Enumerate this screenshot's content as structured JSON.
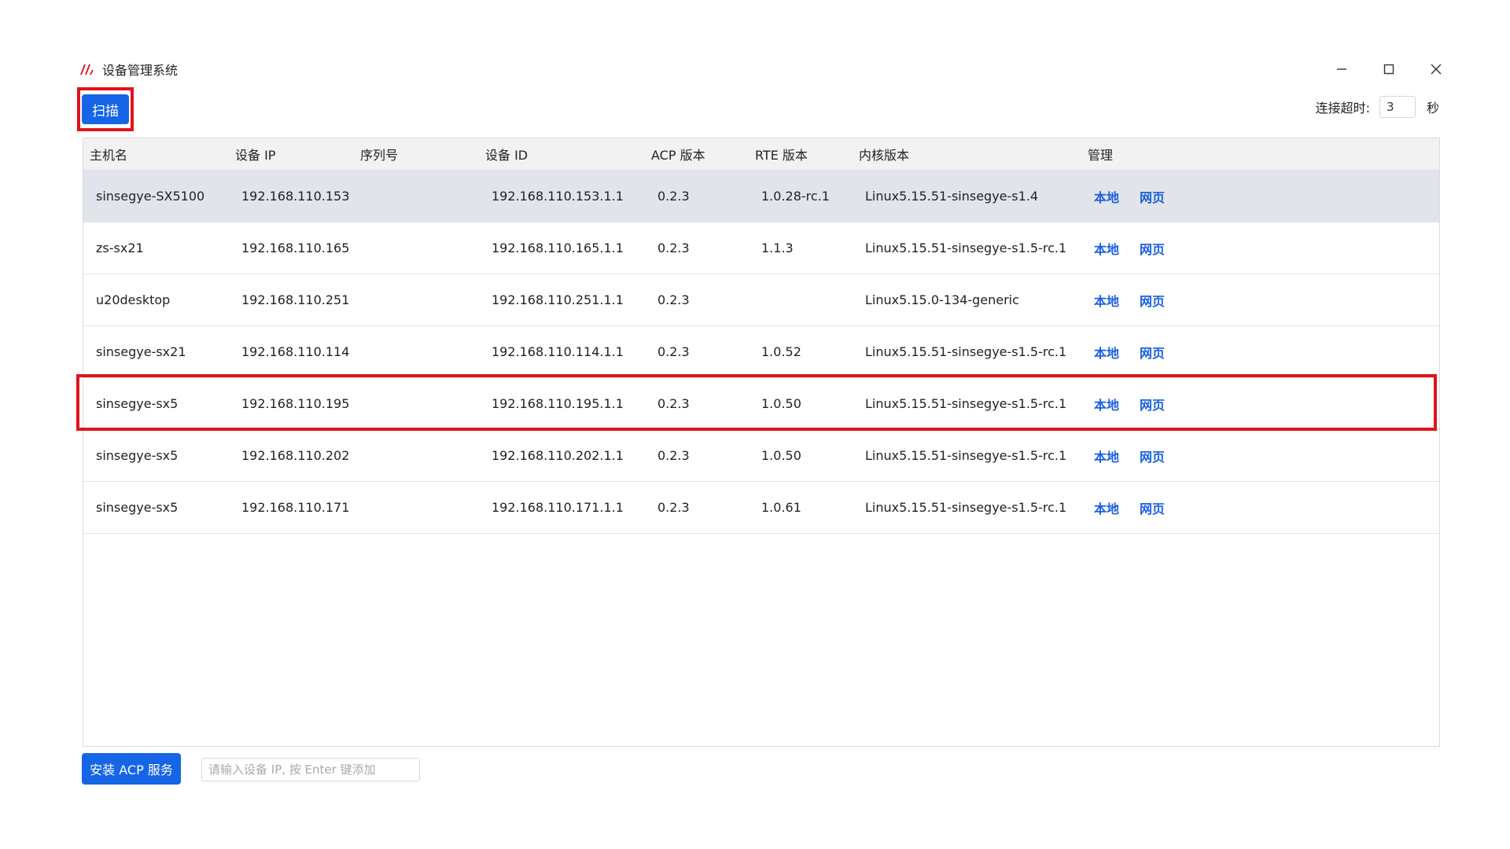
{
  "window": {
    "title": "设备管理系统",
    "controls": [
      "minimize-icon",
      "maximize-icon",
      "close-icon"
    ]
  },
  "toolbar": {
    "scan_label": "扫描",
    "timeout_label": "连接超时:",
    "timeout_value": "3",
    "timeout_unit": "秒"
  },
  "table": {
    "headers": {
      "host": "主机名",
      "ip": "设备 IP",
      "sn": "序列号",
      "id": "设备 ID",
      "acp": "ACP 版本",
      "rte": "RTE 版本",
      "kernel": "内核版本",
      "mgmt": "管理"
    },
    "rows": [
      {
        "host": "sinsegye-SX5100",
        "ip": "192.168.110.153",
        "sn": "",
        "id": "192.168.110.153.1.1",
        "acp": "0.2.3",
        "rte": "1.0.28-rc.1",
        "kernel": "Linux5.15.51-sinsegye-s1.4",
        "local": "本地",
        "web": "网页"
      },
      {
        "host": "zs-sx21",
        "ip": "192.168.110.165",
        "sn": "",
        "id": "192.168.110.165.1.1",
        "acp": "0.2.3",
        "rte": "1.1.3",
        "kernel": "Linux5.15.51-sinsegye-s1.5-rc.1",
        "local": "本地",
        "web": "网页"
      },
      {
        "host": "u20desktop",
        "ip": "192.168.110.251",
        "sn": "",
        "id": "192.168.110.251.1.1",
        "acp": "0.2.3",
        "rte": "",
        "kernel": "Linux5.15.0-134-generic",
        "local": "本地",
        "web": "网页"
      },
      {
        "host": "sinsegye-sx21",
        "ip": "192.168.110.114",
        "sn": "",
        "id": "192.168.110.114.1.1",
        "acp": "0.2.3",
        "rte": "1.0.52",
        "kernel": "Linux5.15.51-sinsegye-s1.5-rc.1",
        "local": "本地",
        "web": "网页"
      },
      {
        "host": "sinsegye-sx5",
        "ip": "192.168.110.195",
        "sn": "",
        "id": "192.168.110.195.1.1",
        "acp": "0.2.3",
        "rte": "1.0.50",
        "kernel": "Linux5.15.51-sinsegye-s1.5-rc.1",
        "local": "本地",
        "web": "网页"
      },
      {
        "host": "sinsegye-sx5",
        "ip": "192.168.110.202",
        "sn": "",
        "id": "192.168.110.202.1.1",
        "acp": "0.2.3",
        "rte": "1.0.50",
        "kernel": "Linux5.15.51-sinsegye-s1.5-rc.1",
        "local": "本地",
        "web": "网页"
      },
      {
        "host": "sinsegye-sx5",
        "ip": "192.168.110.171",
        "sn": "",
        "id": "192.168.110.171.1.1",
        "acp": "0.2.3",
        "rte": "1.0.61",
        "kernel": "Linux5.15.51-sinsegye-s1.5-rc.1",
        "local": "本地",
        "web": "网页"
      }
    ]
  },
  "footer": {
    "install_label": "安装 ACP 服务",
    "ip_placeholder": "请输入设备 IP, 按 Enter 键添加"
  },
  "colors": {
    "accent": "#1565e6",
    "link": "#1a5fe0",
    "highlight": "#e0131d",
    "logo": "#e0131d"
  }
}
